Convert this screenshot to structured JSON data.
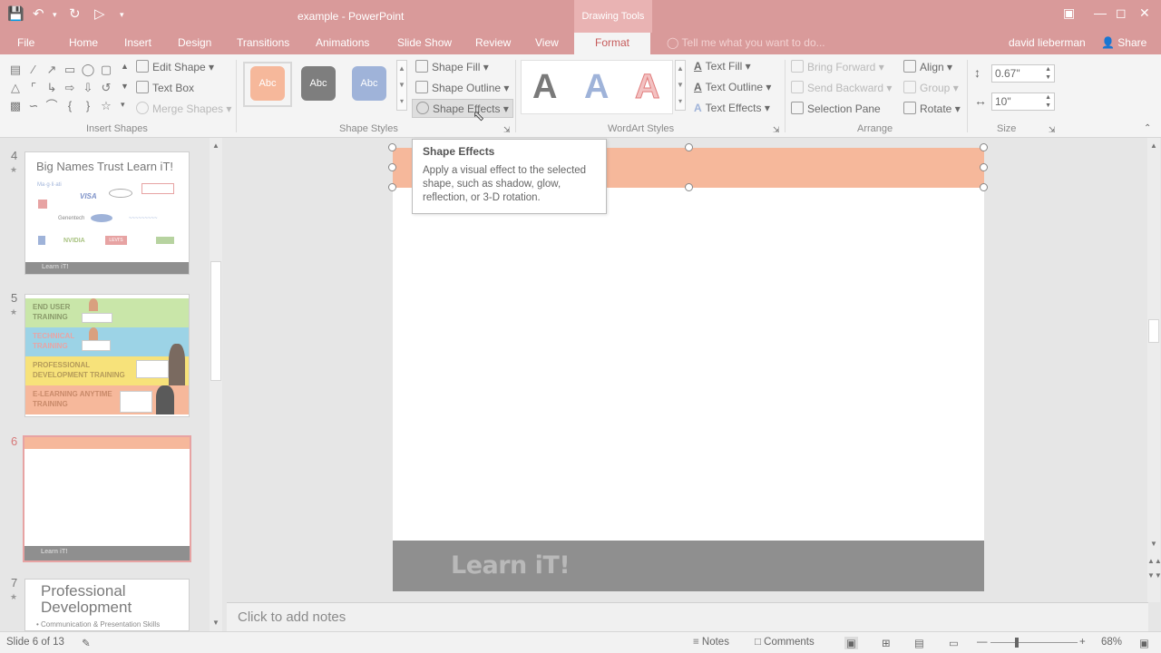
{
  "app": {
    "window_title": "example - PowerPoint",
    "context_tab_group": "Drawing Tools"
  },
  "tabs": [
    "File",
    "Home",
    "Insert",
    "Design",
    "Transitions",
    "Animations",
    "Slide Show",
    "Review",
    "View",
    "Format"
  ],
  "active_tab": "Format",
  "tell_me": "Tell me what you want to do...",
  "user": "david lieberman",
  "share": "Share",
  "ribbon": {
    "insert_shapes": {
      "label": "Insert Shapes",
      "edit_shape": "Edit Shape",
      "text_box": "Text Box",
      "merge_shapes": "Merge Shapes"
    },
    "shape_styles": {
      "label": "Shape Styles",
      "swatch_text": "Abc",
      "swatch_colors": [
        "#f6b89b",
        "#7e7e7e",
        "#9fb3d9"
      ],
      "shape_fill": "Shape Fill",
      "shape_outline": "Shape Outline",
      "shape_effects": "Shape Effects"
    },
    "wordart": {
      "label": "WordArt Styles",
      "glyph": "A",
      "text_fill": "Text Fill",
      "text_outline": "Text Outline",
      "text_effects": "Text Effects"
    },
    "arrange": {
      "label": "Arrange",
      "bring_forward": "Bring Forward",
      "send_backward": "Send Backward",
      "selection_pane": "Selection Pane",
      "align": "Align",
      "group": "Group",
      "rotate": "Rotate"
    },
    "size": {
      "label": "Size",
      "height": "0.67\"",
      "width": "10\""
    }
  },
  "tooltip": {
    "title": "Shape Effects",
    "body": "Apply a visual effect to the selected shape, such as shadow, glow, reflection, or 3-D rotation."
  },
  "thumbnails": [
    {
      "number": "4",
      "title": "Big Names Trust Learn iT!",
      "logos": [
        "VISA",
        "NVIDIA",
        "LEVI'S"
      ],
      "footer": "Learn iT!"
    },
    {
      "number": "5",
      "rows": [
        "END USER TRAINING",
        "TECHNICAL TRAINING",
        "PROFESSIONAL DEVELOPMENT TRAINING",
        "E-LEARNING ANYTIME TRAINING"
      ],
      "row_colors": [
        "#c9e6a9",
        "#9cd3e6",
        "#f7e27a",
        "#f6b89b"
      ]
    },
    {
      "number": "6",
      "footer": "Learn iT!"
    },
    {
      "number": "7",
      "title": "Professional Development",
      "bullet": "• Communication & Presentation Skills"
    }
  ],
  "slide": {
    "footer_logo": "Learn iT!",
    "bar_color": "#f6b89b"
  },
  "notes_placeholder": "Click to add notes",
  "status": {
    "slide_info": "Slide 6 of 13",
    "notes": "Notes",
    "comments": "Comments",
    "zoom": "68%"
  }
}
